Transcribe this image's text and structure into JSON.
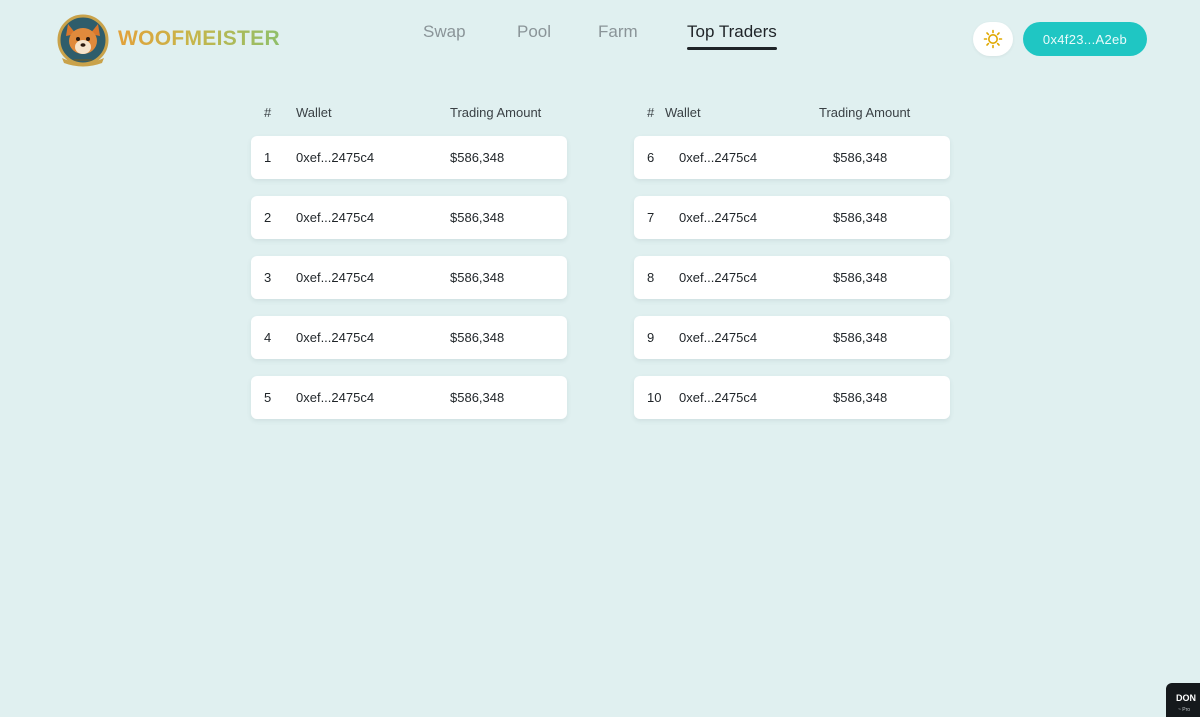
{
  "brand": {
    "name": "WOOFMEISTER",
    "logo_icon": "shiba-dog-crest-icon"
  },
  "nav": {
    "items": [
      {
        "label": "Swap",
        "active": false
      },
      {
        "label": "Pool",
        "active": false
      },
      {
        "label": "Farm",
        "active": false
      },
      {
        "label": "Top Traders",
        "active": true
      }
    ]
  },
  "header": {
    "theme_toggle_icon": "sun-icon",
    "wallet_button_label": "0x4f23...A2eb",
    "accent_color": "#1fc6c3"
  },
  "leaderboard": {
    "columns": {
      "rank": "#",
      "wallet": "Wallet",
      "amount": "Trading Amount"
    },
    "left": [
      {
        "rank": "1",
        "wallet": "0xef...2475c4",
        "amount": "$586,348"
      },
      {
        "rank": "2",
        "wallet": "0xef...2475c4",
        "amount": "$586,348"
      },
      {
        "rank": "3",
        "wallet": "0xef...2475c4",
        "amount": "$586,348"
      },
      {
        "rank": "4",
        "wallet": "0xef...2475c4",
        "amount": "$586,348"
      },
      {
        "rank": "5",
        "wallet": "0xef...2475c4",
        "amount": "$586,348"
      }
    ],
    "right": [
      {
        "rank": "6",
        "wallet": "0xef...2475c4",
        "amount": "$586,348"
      },
      {
        "rank": "7",
        "wallet": "0xef...2475c4",
        "amount": "$586,348"
      },
      {
        "rank": "8",
        "wallet": "0xef...2475c4",
        "amount": "$586,348"
      },
      {
        "rank": "9",
        "wallet": "0xef...2475c4",
        "amount": "$586,348"
      },
      {
        "rank": "10",
        "wallet": "0xef...2475c4",
        "amount": "$586,348"
      }
    ]
  },
  "corner_widget": {
    "title": "DON",
    "sub": "~ Pro"
  }
}
